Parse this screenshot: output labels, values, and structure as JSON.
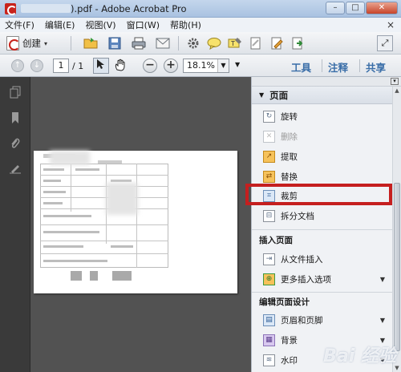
{
  "window": {
    "title_suffix": ").pdf - Adobe Acrobat Pro",
    "controls": {
      "minimize": "–",
      "maximize": "□",
      "close": "✕"
    }
  },
  "menu": {
    "items": [
      {
        "label": "文件(F)"
      },
      {
        "label": "编辑(E)"
      },
      {
        "label": "视图(V)"
      },
      {
        "label": "窗口(W)"
      },
      {
        "label": "帮助(H)"
      }
    ],
    "close": "×"
  },
  "toolbar": {
    "create_label": "创建",
    "create_caret": "▾",
    "expand": "⤢"
  },
  "navbar": {
    "current_page": "1",
    "total_pages": "/ 1",
    "zoom": "18.1%",
    "zoom_out": "−",
    "zoom_in": "+",
    "tabs": [
      "工具",
      "注释",
      "共享"
    ]
  },
  "right_pane": {
    "section_title": "页面",
    "pages_items": [
      {
        "label": "旋转",
        "icon": "rotate-icon",
        "enabled": true
      },
      {
        "label": "删除",
        "icon": "delete-icon",
        "enabled": false
      },
      {
        "label": "提取",
        "icon": "extract-icon",
        "enabled": true
      },
      {
        "label": "替换",
        "icon": "replace-icon",
        "enabled": true
      },
      {
        "label": "裁剪",
        "icon": "crop-icon",
        "enabled": true,
        "highlighted": true
      },
      {
        "label": "拆分文档",
        "icon": "split-icon",
        "enabled": true
      }
    ],
    "insert_title": "插入页面",
    "insert_items": [
      {
        "label": "从文件插入",
        "icon": "insert-file-icon"
      },
      {
        "label": "更多插入选项",
        "icon": "more-insert-icon",
        "dropdown": true
      }
    ],
    "design_title": "编辑页面设计",
    "design_items": [
      {
        "label": "页眉和页脚",
        "icon": "header-footer-icon",
        "dropdown": true
      },
      {
        "label": "背景",
        "icon": "background-icon",
        "dropdown": true
      },
      {
        "label": "水印",
        "icon": "watermark-icon",
        "dropdown": true
      }
    ]
  },
  "watermark": "Bai 经验"
}
